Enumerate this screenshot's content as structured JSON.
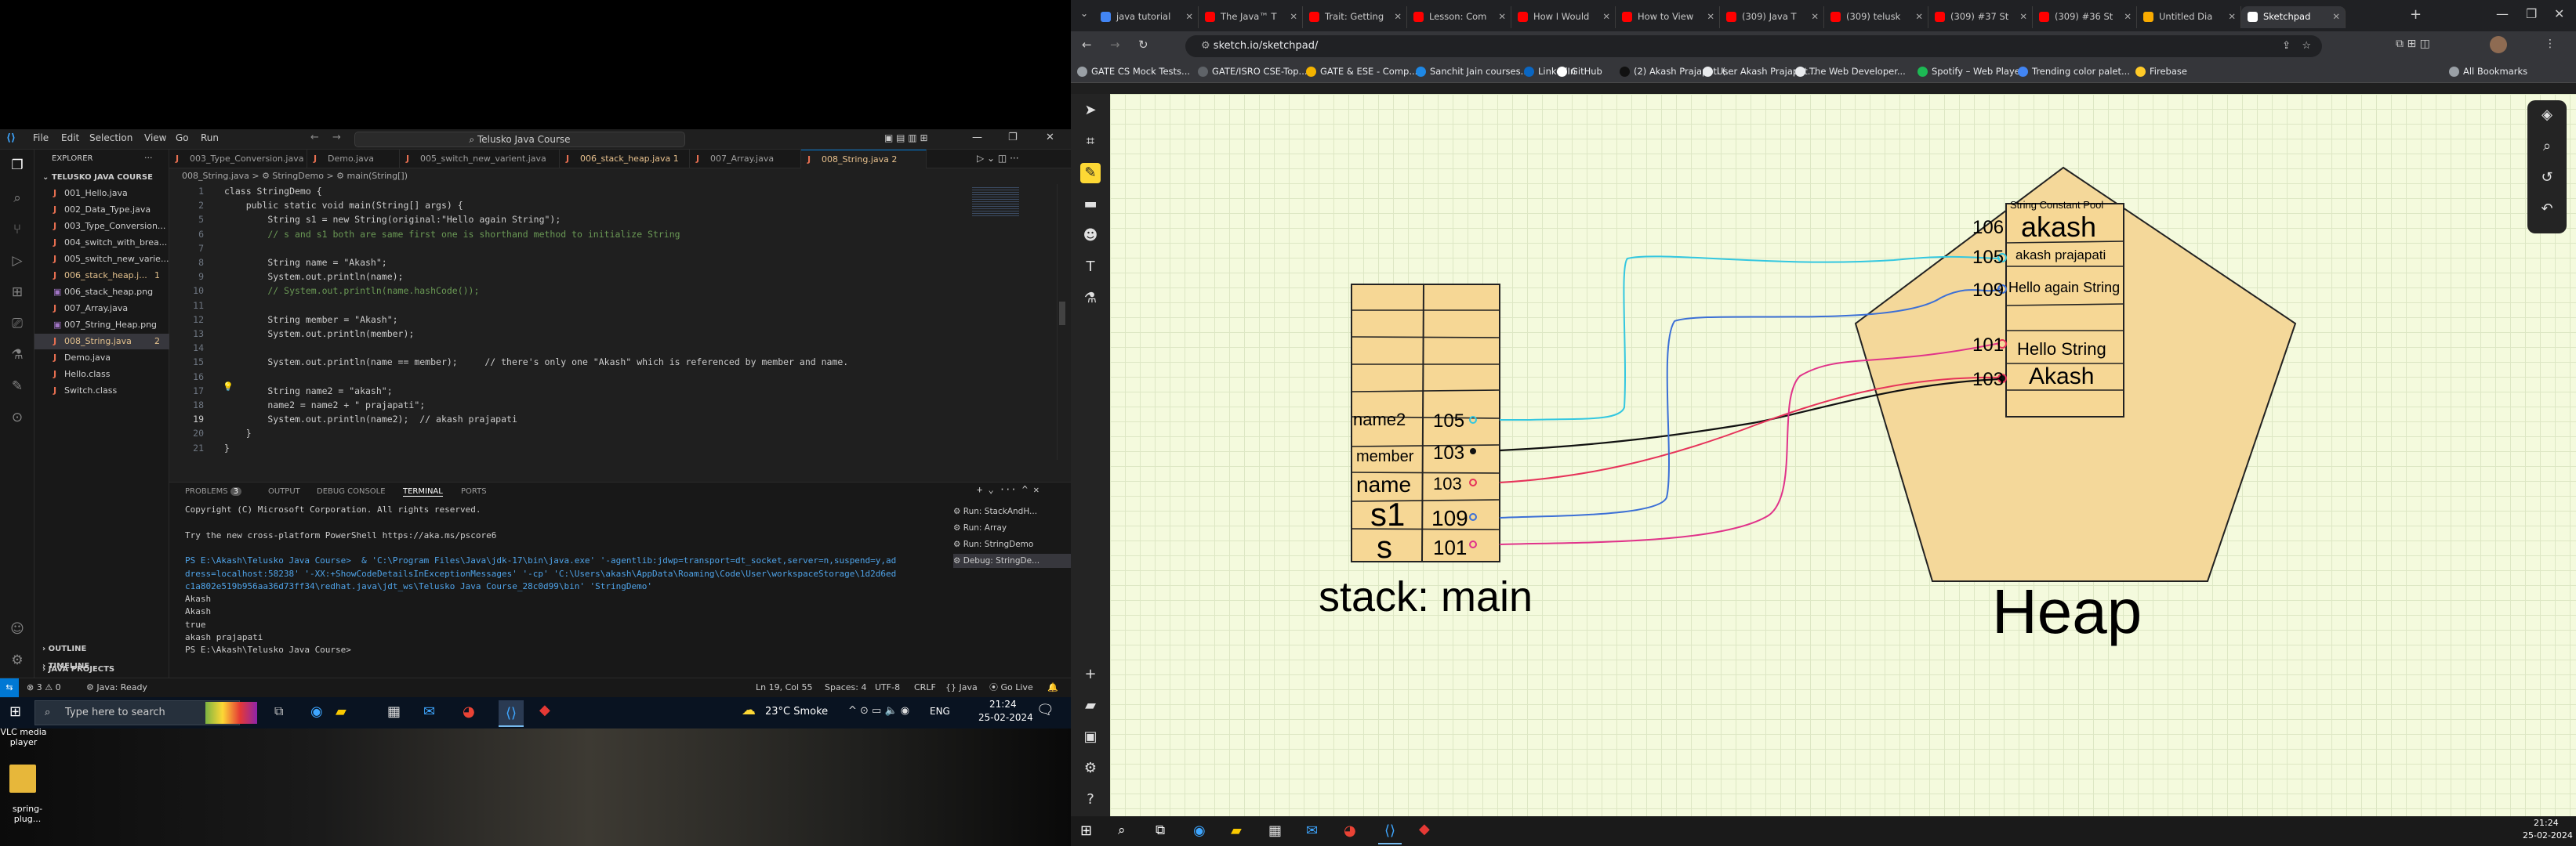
{
  "vscode": {
    "menu": [
      "File",
      "Edit",
      "Selection",
      "View",
      "Go",
      "Run"
    ],
    "search": "Telusko Java Course",
    "explorer": {
      "title": "EXPLORER",
      "root": "TELUSKO JAVA COURSE",
      "files": [
        {
          "name": "001_Hello.java",
          "badge": ""
        },
        {
          "name": "002_Data_Type.java",
          "badge": ""
        },
        {
          "name": "003_Type_Conversion...",
          "badge": ""
        },
        {
          "name": "004_switch_with_brea...",
          "badge": ""
        },
        {
          "name": "005_switch_new_varie...",
          "badge": ""
        },
        {
          "name": "006_stack_heap.j...",
          "badge": "1"
        },
        {
          "name": "006_stack_heap.png",
          "badge": ""
        },
        {
          "name": "007_Array.java",
          "badge": ""
        },
        {
          "name": "007_String_Heap.png",
          "badge": ""
        },
        {
          "name": "008_String.java",
          "badge": "2"
        },
        {
          "name": "Demo.java",
          "badge": ""
        },
        {
          "name": "Hello.class",
          "badge": ""
        },
        {
          "name": "Switch.class",
          "badge": ""
        }
      ],
      "sections": [
        "OUTLINE",
        "TIMELINE",
        "JAVA PROJECTS"
      ]
    },
    "tabs": [
      "003_Type_Conversion.java",
      "Demo.java",
      "005_switch_new_varient.java",
      "006_stack_heap.java 1",
      "007_Array.java",
      "008_String.java 2"
    ],
    "breadcrumb": "008_String.java > ⚙ StringDemo > ⚙ main(String[])",
    "code": [
      {
        "n": "1",
        "t": "class StringDemo {"
      },
      {
        "n": "2",
        "t": "    public static void main(String[] args) {"
      },
      {
        "n": "5",
        "t": "        String s1 = new String(original:\"Hello again String\");"
      },
      {
        "n": "6",
        "t": "        // s and s1 both are same first one is shorthand method to initialize String"
      },
      {
        "n": "7",
        "t": ""
      },
      {
        "n": "8",
        "t": "        String name = \"Akash\";"
      },
      {
        "n": "9",
        "t": "        System.out.println(name);"
      },
      {
        "n": "10",
        "t": "        // System.out.println(name.hashCode());"
      },
      {
        "n": "11",
        "t": ""
      },
      {
        "n": "12",
        "t": "        String member = \"Akash\";"
      },
      {
        "n": "13",
        "t": "        System.out.println(member);"
      },
      {
        "n": "14",
        "t": ""
      },
      {
        "n": "15",
        "t": "        System.out.println(name == member);     // there's only one \"Akash\" which is referenced by member and name."
      },
      {
        "n": "16",
        "t": ""
      },
      {
        "n": "17",
        "t": "        String name2 = \"akash\";"
      },
      {
        "n": "18",
        "t": "        name2 = name2 + \" prajapati\";"
      },
      {
        "n": "19",
        "t": "        System.out.println(name2);  // akash prajapati"
      },
      {
        "n": "20",
        "t": "    }"
      },
      {
        "n": "21",
        "t": "}"
      }
    ],
    "panel_tabs": [
      "PROBLEMS",
      "OUTPUT",
      "DEBUG CONSOLE",
      "TERMINAL",
      "PORTS"
    ],
    "problems_count": "3",
    "terminal": [
      "Copyright (C) Microsoft Corporation. All rights reserved.",
      "",
      "Try the new cross-platform PowerShell https://aka.ms/pscore6",
      "",
      "PS E:\\Akash\\Telusko Java Course>  & 'C:\\Program Files\\Java\\jdk-17\\bin\\java.exe' '-agentlib:jdwp=transport=dt_socket,server=n,suspend=y,ad",
      "dress=localhost:58238' '-XX:+ShowCodeDetailsInExceptionMessages' '-cp' 'C:\\Users\\akash\\AppData\\Roaming\\Code\\User\\workspaceStorage\\1d2d6ed",
      "c1a802e519b956aa36d73ff34\\redhat.java\\jdt_ws\\Telusko Java Course_28c0d99\\bin' 'StringDemo'",
      "Akash",
      "Akash",
      "true",
      "akash prajapati",
      "PS E:\\Akash\\Telusko Java Course> "
    ],
    "run_list": [
      "Run: StackAndH...",
      "Run: Array",
      "Run: StringDemo",
      "Debug: StringDe..."
    ],
    "status": {
      "errors": "3",
      "warnings": "0",
      "java": "Java: Ready",
      "position": "Ln 19, Col 55",
      "spaces": "Spaces: 4",
      "encoding": "UTF-8",
      "eol": "CRLF",
      "lang": "Java",
      "golive": "Go Live"
    }
  },
  "taskbar_left": {
    "search_placeholder": "Type here to search",
    "weather": "23°C  Smoke",
    "lang": "ENG",
    "time": "21:24",
    "date": "25-02-2024",
    "desktop_icons": [
      "VLC media player",
      "spring-plug..."
    ]
  },
  "chrome": {
    "tabs": [
      "java tutorial",
      "The Java™ T",
      "Trait: Getting",
      "Lesson: Com",
      "How I Would",
      "How to View",
      "(309) Java T",
      "(309) telusk",
      "(309) #37 St",
      "(309) #36 St",
      "Untitled Dia",
      "Sketchpad"
    ],
    "url": "sketch.io/sketchpad/",
    "bookmarks": [
      "GATE CS Mock Tests...",
      "GATE/ISRO CSE-Top...",
      "GATE & ESE - Comp...",
      "Sanchit Jain courses...",
      "LinkedIn",
      "GitHub",
      "(2) Akash Prajapati (...",
      "User Akash Prajapat...",
      "The Web Developer...",
      "Spotify – Web Player",
      "Trending color palet...",
      "Firebase",
      "All Bookmarks"
    ],
    "time": "21:24",
    "date": "25-02-2024"
  },
  "sketch": {
    "stack_label": "stack: main",
    "heap_label": "Heap",
    "pool_label": "String Constant Pool",
    "stack_rows": [
      {
        "name": "name2",
        "addr": "105"
      },
      {
        "name": "member",
        "addr": "103"
      },
      {
        "name": "name",
        "addr": "103"
      },
      {
        "name": "s1",
        "addr": "109"
      },
      {
        "name": "s",
        "addr": "101"
      }
    ],
    "heap_rows": [
      {
        "addr": "106",
        "value": "akash"
      },
      {
        "addr": "105",
        "value": "akash prajapati"
      },
      {
        "addr": "109",
        "value": "Hello again String"
      },
      {
        "addr": "101",
        "value": "Hello String"
      },
      {
        "addr": "103",
        "value": "Akash"
      }
    ]
  }
}
